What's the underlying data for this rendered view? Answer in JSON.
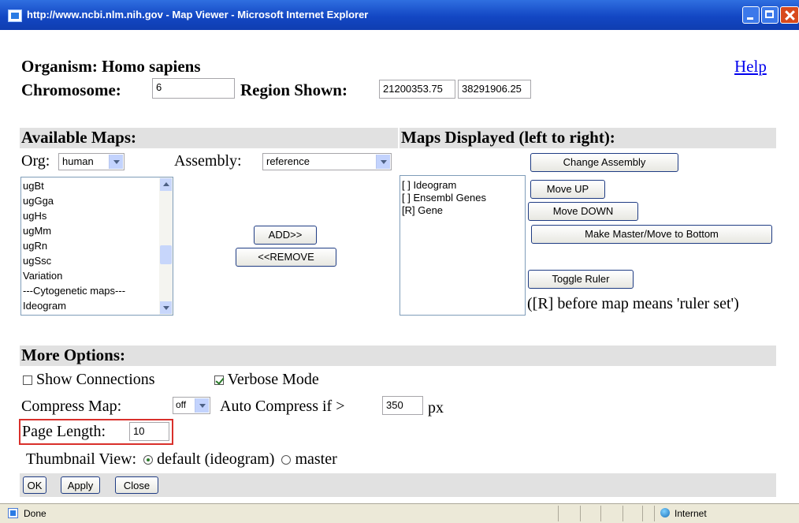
{
  "window": {
    "title": "http://www.ncbi.nlm.nih.gov - Map Viewer - Microsoft Internet Explorer"
  },
  "header": {
    "organism": "Organism: Homo sapiens",
    "help_link": "Help",
    "chromosome_label": "Chromosome:",
    "chromosome_value": "6",
    "region_label": "Region Shown:",
    "region_start": "21200353.75",
    "region_end": "38291906.25"
  },
  "available_maps": {
    "heading": "Available Maps:",
    "org_label": "Org:",
    "org_value": "human",
    "assembly_label": "Assembly:",
    "assembly_value": "reference",
    "list": [
      "ugBt",
      "ugGga",
      "ugHs",
      "ugMm",
      "ugRn",
      "ugSsc",
      "Variation",
      "---Cytogenetic maps---",
      "Ideogram"
    ]
  },
  "transfer": {
    "add_label": "ADD>>",
    "remove_label": "<<REMOVE"
  },
  "maps_displayed": {
    "heading": "Maps Displayed (left to right):",
    "list": [
      "[ ] Ideogram",
      "[ ] Ensembl Genes",
      "[R] Gene"
    ],
    "change_assembly": "Change Assembly",
    "move_up": "Move UP",
    "move_down": "Move DOWN",
    "make_master": "Make Master/Move to Bottom",
    "toggle_ruler": "Toggle Ruler",
    "ruler_note": "([R] before map means 'ruler set')"
  },
  "more_options": {
    "heading": "More Options:",
    "show_connections": "Show Connections",
    "show_connections_checked": false,
    "verbose_mode": "Verbose Mode",
    "verbose_mode_checked": true,
    "compress_label": "Compress Map:",
    "compress_value": "off",
    "auto_compress_label": "Auto Compress if >",
    "auto_compress_value": "350",
    "auto_compress_unit": "px",
    "page_length_label": "Page Length:",
    "page_length_value": "10",
    "thumbnail_label": "Thumbnail View:",
    "thumbnail_default": "default (ideogram)",
    "thumbnail_master": "master",
    "thumbnail_selected": "default (ideogram)"
  },
  "actions": {
    "ok": "OK",
    "apply": "Apply",
    "close": "Close"
  },
  "statusbar": {
    "status": "Done",
    "zone": "Internet"
  },
  "colors": {
    "titlebar": "#1347c4",
    "band": "#e1e1e1",
    "highlight_box": "#d9302b",
    "link": "#0000ee"
  }
}
